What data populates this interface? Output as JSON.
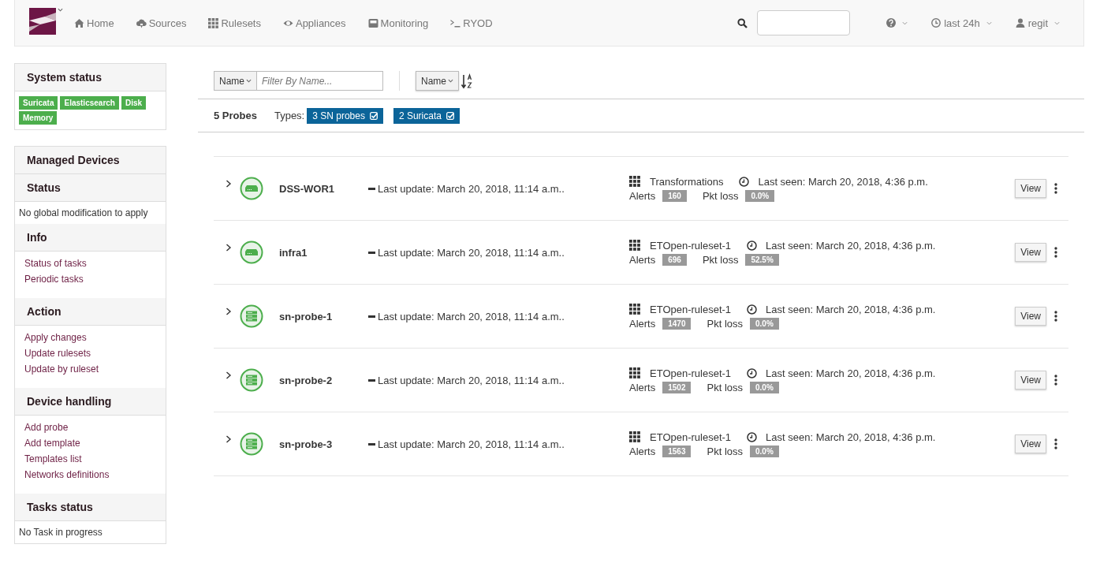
{
  "navbar": {
    "items": [
      {
        "kind": "home",
        "label": "Home"
      },
      {
        "kind": "cloud",
        "label": "Sources"
      },
      {
        "kind": "grid",
        "label": "Rulesets"
      },
      {
        "kind": "eye",
        "label": "Appliances"
      },
      {
        "kind": "monitor",
        "label": "Monitoring"
      },
      {
        "kind": "terminal",
        "label": "RYOD"
      }
    ],
    "right": [
      {
        "kind": "help"
      },
      {
        "kind": "clock",
        "label": "last 24h"
      },
      {
        "kind": "user",
        "label": "regit"
      }
    ]
  },
  "sidebar": {
    "system_status": {
      "title": "System status",
      "labels": [
        "Suricata",
        "Elasticsearch",
        "Disk",
        "Memory"
      ]
    },
    "managed_devices": {
      "title": "Managed Devices",
      "sections": [
        {
          "title": "Status",
          "kind": "text",
          "items": [
            "No global modification to apply"
          ]
        },
        {
          "title": "Info",
          "kind": "links",
          "items": [
            "Status of tasks",
            "Periodic tasks"
          ]
        },
        {
          "title": "Action",
          "kind": "links",
          "items": [
            "Apply changes",
            "Update rulesets",
            "Update by ruleset"
          ]
        },
        {
          "title": "Device handling",
          "kind": "links",
          "items": [
            "Add probe",
            "Add template",
            "Templates list",
            "Networks definitions"
          ]
        },
        {
          "title": "Tasks status",
          "kind": "text",
          "items": [
            "No Task in progress"
          ]
        }
      ]
    }
  },
  "toolbar": {
    "filter_field": "Name",
    "filter_placeholder": "Filter By Name...",
    "sort_field": "Name",
    "count": "5 Probes",
    "types_label": "Types:",
    "types": [
      {
        "label": "3 SN probes",
        "checked": true
      },
      {
        "label": "2 Suricata",
        "checked": true
      }
    ]
  },
  "probes": [
    {
      "kind": "appliance",
      "name": "DSS-WOR1",
      "last_update": "Last update: March 20, 2018, 11:14 a.m..",
      "ruleset": "Transformations",
      "last_seen": "Last seen: March 20, 2018, 4:36 p.m.",
      "alerts_label": "Alerts",
      "alerts": "160",
      "pkt_loss_label": "Pkt loss",
      "pkt_loss": "0.0%",
      "button": "View"
    },
    {
      "kind": "appliance",
      "name": "infra1",
      "last_update": "Last update: March 20, 2018, 11:14 a.m..",
      "ruleset": "ETOpen-ruleset-1",
      "last_seen": "Last seen: March 20, 2018, 4:36 p.m.",
      "alerts_label": "Alerts",
      "alerts": "696",
      "pkt_loss_label": "Pkt loss",
      "pkt_loss": "52.5%",
      "button": "View"
    },
    {
      "kind": "sn-probe",
      "name": "sn-probe-1",
      "last_update": "Last update: March 20, 2018, 11:14 a.m..",
      "ruleset": "ETOpen-ruleset-1",
      "last_seen": "Last seen: March 20, 2018, 4:36 p.m.",
      "alerts_label": "Alerts",
      "alerts": "1470",
      "pkt_loss_label": "Pkt loss",
      "pkt_loss": "0.0%",
      "button": "View"
    },
    {
      "kind": "sn-probe",
      "name": "sn-probe-2",
      "last_update": "Last update: March 20, 2018, 11:14 a.m..",
      "ruleset": "ETOpen-ruleset-1",
      "last_seen": "Last seen: March 20, 2018, 4:36 p.m.",
      "alerts_label": "Alerts",
      "alerts": "1502",
      "pkt_loss_label": "Pkt loss",
      "pkt_loss": "0.0%",
      "button": "View"
    },
    {
      "kind": "sn-probe",
      "name": "sn-probe-3",
      "last_update": "Last update: March 20, 2018, 11:14 a.m..",
      "ruleset": "ETOpen-ruleset-1",
      "last_seen": "Last seen: March 20, 2018, 4:36 p.m.",
      "alerts_label": "Alerts",
      "alerts": "1563",
      "pkt_loss_label": "Pkt loss",
      "pkt_loss": "0.0%",
      "button": "View"
    }
  ]
}
